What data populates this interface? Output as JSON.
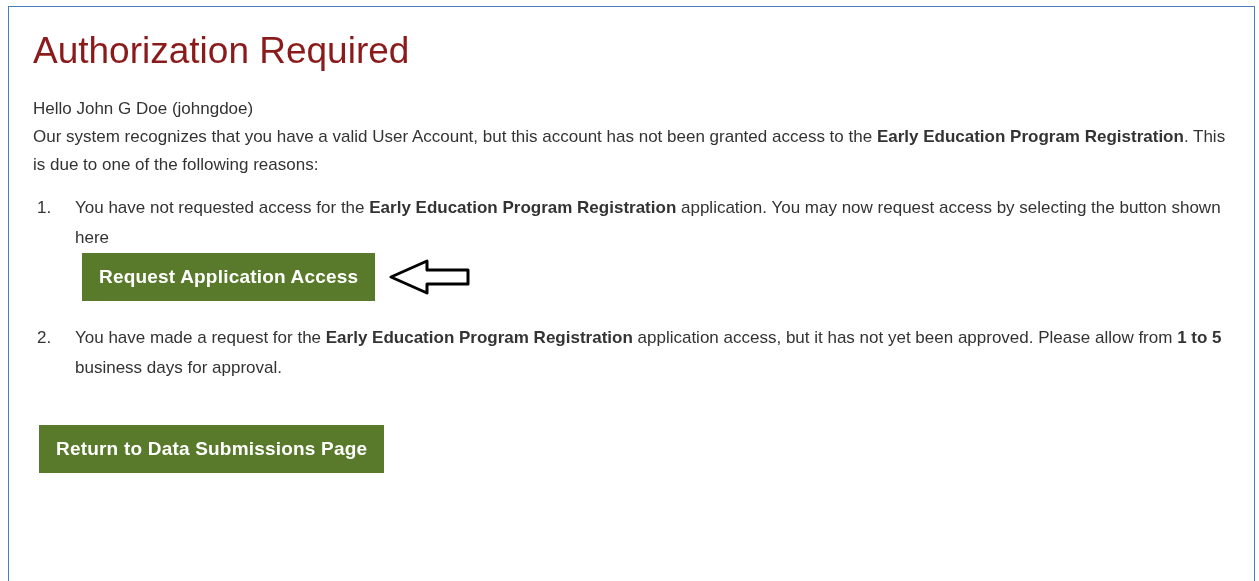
{
  "title": "Authorization Required",
  "greeting": "Hello John G Doe (johngdoe)",
  "intro": "Our system recognizes that you have a valid User Account, but this account has not been granted access to the **Early Education Program Registration**. This is due to one of the following reasons:",
  "reasons": [
    {
      "number": "1.",
      "text": "You have not requested access for the **Early Education Program Registration** application. You may now request access by selecting the button shown here",
      "button": "Request Application Access"
    },
    {
      "number": "2.",
      "text": "You have made a request for the **Early Education Program Registration** application access, but it has not yet been approved. Please allow from **1 to 5** business days for approval."
    }
  ],
  "return_button": "Return to Data Submissions Page"
}
